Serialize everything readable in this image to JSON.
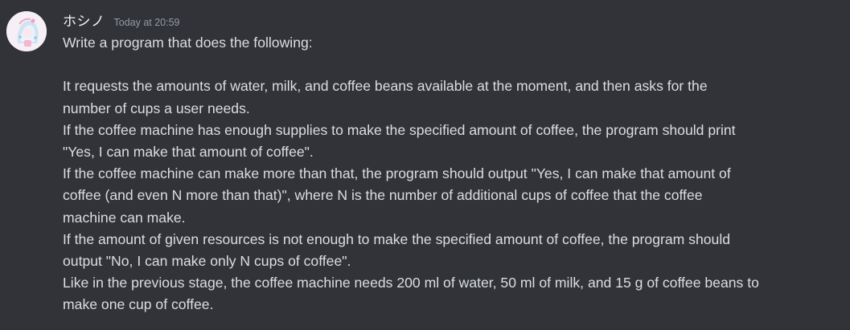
{
  "message": {
    "username": "ホシノ",
    "timestamp": "Today at 20:59",
    "lines": [
      "Write a program that does the following:",
      "",
      "It requests the amounts of water, milk, and coffee beans available at the moment, and then asks for the",
      "number of cups a user needs.",
      "If the coffee machine has enough supplies to make the specified amount of coffee, the program should print",
      "\"Yes, I can make that amount of coffee\".",
      "If the coffee machine can make more than that, the program should output \"Yes, I can make that amount of",
      "coffee (and even N more than that)\", where N is the number of additional cups of coffee that the coffee",
      "machine can make.",
      "If the amount of given resources is not enough to make the specified amount of coffee, the program should",
      "output \"No, I can make only N cups of coffee\".",
      "Like in the previous stage, the coffee machine needs 200 ml of water, 50 ml of milk, and 15 g of coffee beans to",
      "make one cup of coffee."
    ]
  },
  "colors": {
    "background": "#313338",
    "username": "#f2f3f5",
    "timestamp": "#949ba4",
    "text": "#dbdee1"
  },
  "icons": {
    "avatar": "user-avatar"
  }
}
